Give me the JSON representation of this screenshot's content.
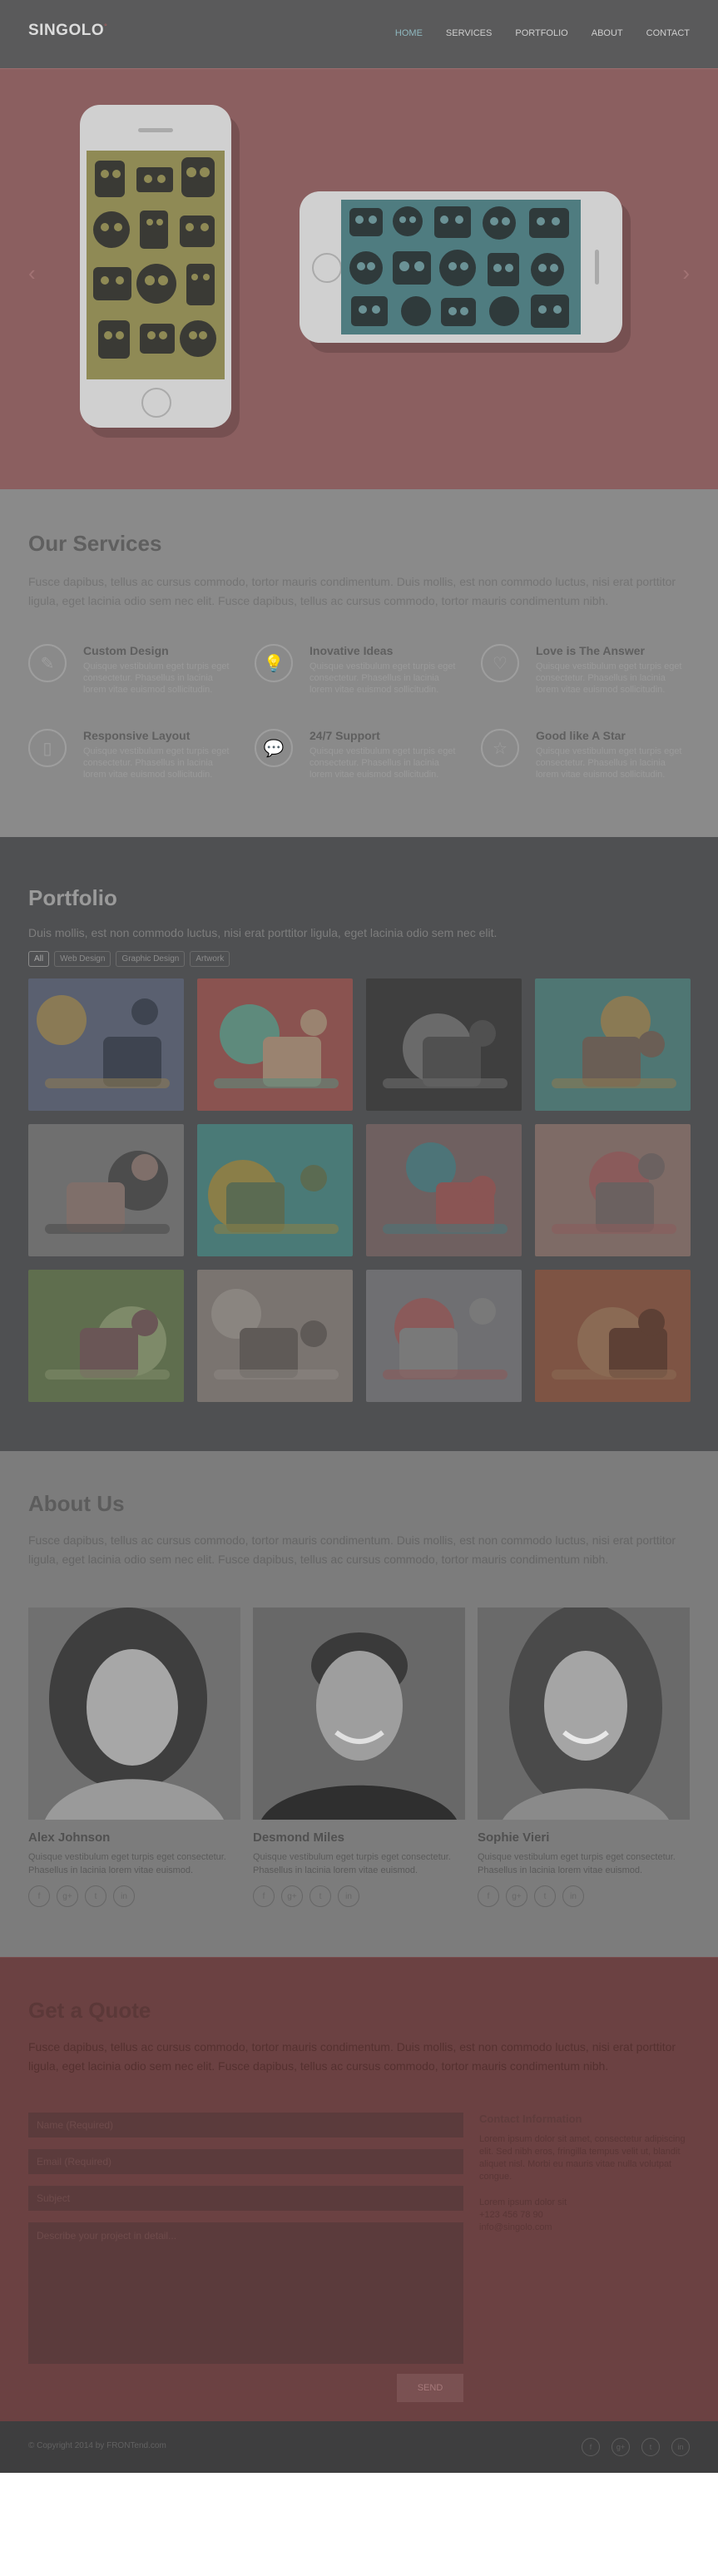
{
  "header": {
    "logo": "SINGOLO",
    "logo_mark": "°",
    "nav": [
      "HOME",
      "SERVICES",
      "PORTFOLIO",
      "ABOUT",
      "CONTACT"
    ],
    "active_index": 0
  },
  "slider": {
    "left_arrow": "‹",
    "right_arrow": "›"
  },
  "services": {
    "title": "Our Services",
    "intro": "Fusce dapibus, tellus ac cursus commodo, tortor mauris condimentum. Duis mollis, est non commodo luctus, nisi erat porttitor ligula, eget lacinia odio sem nec elit. Fusce dapibus, tellus ac cursus commodo, tortor mauris condimentum nibh.",
    "items": [
      {
        "icon": "pencil-icon",
        "glyph": "✎",
        "title": "Custom Design",
        "text": "Quisque vestibulum eget turpis eget consectetur. Phasellus in lacinia lorem vitae euismod sollicitudin."
      },
      {
        "icon": "lightbulb-icon",
        "glyph": "💡",
        "title": "Inovative Ideas",
        "text": "Quisque vestibulum eget turpis eget consectetur. Phasellus in lacinia lorem vitae euismod sollicitudin."
      },
      {
        "icon": "heart-icon",
        "glyph": "♡",
        "title": "Love is The Answer",
        "text": "Quisque vestibulum eget turpis eget consectetur. Phasellus in lacinia lorem vitae euismod sollicitudin."
      },
      {
        "icon": "tablet-icon",
        "glyph": "▯",
        "title": "Responsive Layout",
        "text": "Quisque vestibulum eget turpis eget consectetur. Phasellus in lacinia lorem vitae euismod sollicitudin."
      },
      {
        "icon": "chat-icon",
        "glyph": "💬",
        "title": "24/7 Support",
        "text": "Quisque vestibulum eget turpis eget consectetur. Phasellus in lacinia lorem vitae euismod sollicitudin."
      },
      {
        "icon": "star-icon",
        "glyph": "☆",
        "title": "Good like A Star",
        "text": "Quisque vestibulum eget turpis eget consectetur. Phasellus in lacinia lorem vitae euismod sollicitudin."
      }
    ]
  },
  "portfolio": {
    "title": "Portfolio",
    "intro": "Duis mollis, est non commodo luctus, nisi erat porttitor ligula, eget lacinia odio sem nec elit.",
    "filters": [
      "All",
      "Web Design",
      "Graphic Design",
      "Artwork"
    ],
    "active_filter": 0,
    "tiles": [
      {
        "colors": [
          "#5a6070",
          "#8a7a55",
          "#3e4450"
        ]
      },
      {
        "colors": [
          "#8a5350",
          "#5e8a7c",
          "#9a8370"
        ]
      },
      {
        "colors": [
          "#3f3f3f",
          "#6a6a6a",
          "#505050"
        ]
      },
      {
        "colors": [
          "#4f7673",
          "#8a7a54",
          "#6a5e55"
        ]
      },
      {
        "colors": [
          "#6f6f6f",
          "#4c4c4c",
          "#7f6f6a"
        ]
      },
      {
        "colors": [
          "#4a7a77",
          "#8a7e48",
          "#5b6b52"
        ]
      },
      {
        "colors": [
          "#6f6060",
          "#4d7478",
          "#8a5554"
        ]
      },
      {
        "colors": [
          "#7e6b66",
          "#8a5b5b",
          "#6b6160"
        ]
      },
      {
        "colors": [
          "#5f6e4e",
          "#7e8a69",
          "#6a5656"
        ]
      },
      {
        "colors": [
          "#7a7470",
          "#8a8580",
          "#5f5a57"
        ]
      },
      {
        "colors": [
          "#6f6f72",
          "#8a5a5a",
          "#797979"
        ]
      },
      {
        "colors": [
          "#7e5444",
          "#8a6a54",
          "#5d4035"
        ]
      }
    ]
  },
  "about": {
    "title": "About Us",
    "intro": "Fusce dapibus, tellus ac cursus commodo, tortor mauris condimentum. Duis mollis, est non commodo luctus, nisi erat porttitor ligula, eget lacinia odio sem nec elit. Fusce dapibus, tellus ac cursus commodo, tortor mauris condimentum nibh.",
    "members": [
      {
        "name": "Alex Johnson",
        "role": "Quisque vestibulum eget turpis eget consectetur. Phasellus in lacinia lorem vitae euismod.",
        "social": [
          "f",
          "g+",
          "t",
          "in"
        ]
      },
      {
        "name": "Desmond Miles",
        "role": "Quisque vestibulum eget turpis eget consectetur. Phasellus in lacinia lorem vitae euismod.",
        "social": [
          "f",
          "g+",
          "t",
          "in"
        ]
      },
      {
        "name": "Sophie Vieri",
        "role": "Quisque vestibulum eget turpis eget consectetur. Phasellus in lacinia lorem vitae euismod.",
        "social": [
          "f",
          "g+",
          "t",
          "in"
        ]
      }
    ]
  },
  "quote": {
    "title": "Get a Quote",
    "intro": "Fusce dapibus, tellus ac cursus commodo, tortor mauris condimentum. Duis mollis, est non commodo luctus, nisi erat porttitor ligula, eget lacinia odio sem nec elit. Fusce dapibus, tellus ac cursus commodo, tortor mauris condimentum nibh.",
    "fields": [
      "Name (Required)",
      "Email (Required)",
      "Subject",
      "Describe your project in detail..."
    ],
    "send_label": "SEND",
    "info_title": "Contact Information",
    "info_text": "Lorem ipsum dolor sit amet, consectetur adipiscing elit. Sed nibh eros, fringilla tempus velit ut, blandit aliquet nisl. Morbi eu mauris vitae nulla volutpat congue.",
    "address": "Lorem ipsum dolor sit",
    "phone": "+123 456 78 90",
    "email": "info@singolo.com"
  },
  "footer": {
    "copyright": "© Copyright 2014 by FRONTend.com",
    "social": [
      "f",
      "g+",
      "t",
      "in"
    ]
  }
}
